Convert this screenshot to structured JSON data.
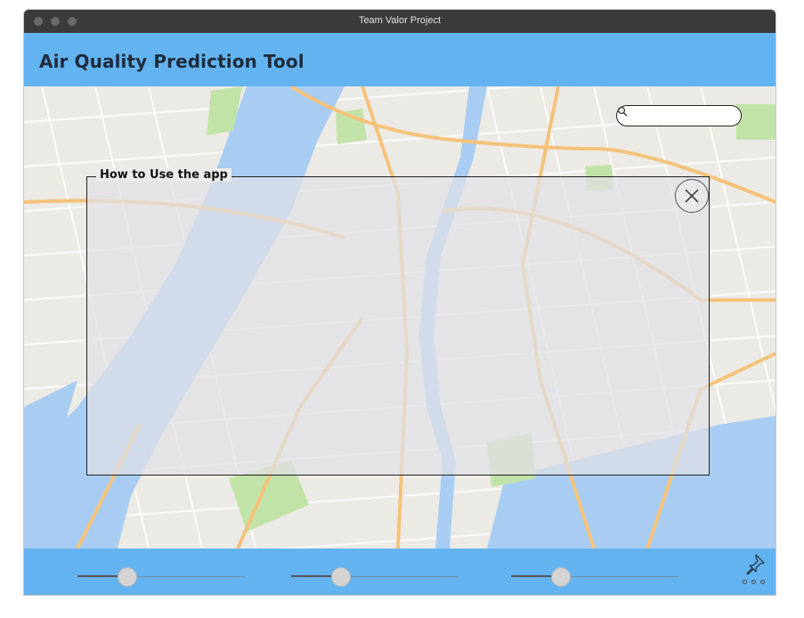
{
  "window": {
    "title": "Team Valor Project"
  },
  "header": {
    "title": "Air Quality Prediction Tool"
  },
  "search": {
    "placeholder": "",
    "value": "",
    "icon": "search-icon"
  },
  "help_panel": {
    "title": "How to Use the app",
    "close_icon": "close-icon"
  },
  "sliders": [
    {
      "name": "slider-1",
      "value_fraction": 0.3
    },
    {
      "name": "slider-2",
      "value_fraction": 0.3
    },
    {
      "name": "slider-3",
      "value_fraction": 0.3
    }
  ],
  "footer": {
    "pin_icon": "pin-icon",
    "more_icon": "more-icon"
  },
  "colors": {
    "accent": "#63b3f1",
    "titlebar": "#3b3b3b",
    "water": "#a9cdf2",
    "land": "#eceae4",
    "park": "#c2e3a8",
    "road": "#f4c27a"
  }
}
